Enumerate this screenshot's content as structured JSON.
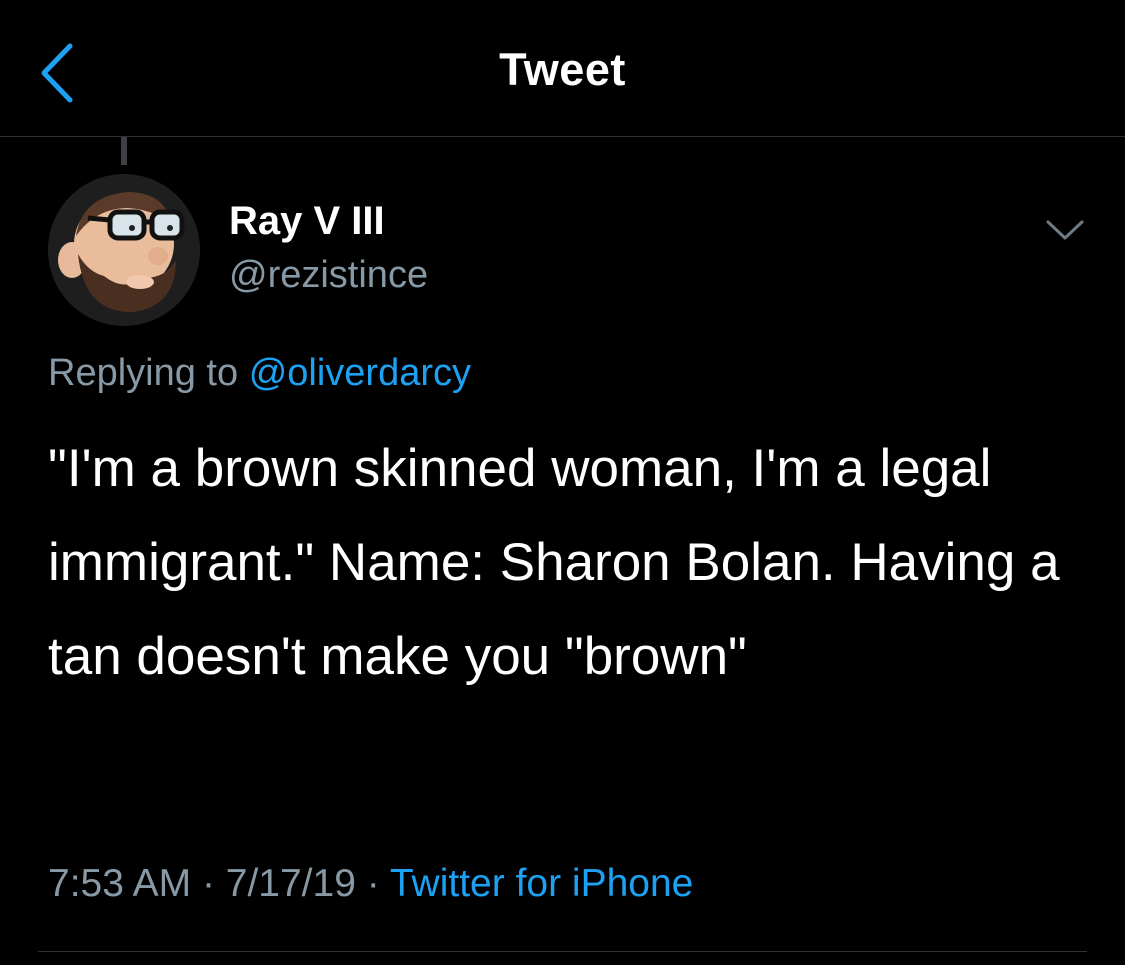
{
  "colors": {
    "background": "#000000",
    "text": "#ffffff",
    "secondary_text": "#8899a6",
    "accent": "#1da1f2",
    "divider": "#2f3336"
  },
  "nav": {
    "back_icon": "chevron-left-icon",
    "title": "Tweet"
  },
  "tweet": {
    "author": {
      "display_name": "Ray V III",
      "handle": "@rezistince",
      "avatar": "cartoon-avatar-bearded-man-with-glasses"
    },
    "menu_icon": "chevron-down-icon",
    "replying_prefix": "Replying to",
    "replying_to": "@oliverdarcy",
    "text": "\"I'm a brown skinned woman, I'm a legal immigrant.\" Name: Sharon Bolan. Having a tan doesn't make you \"brown\"",
    "time": "7:53 AM",
    "date": "7/17/19",
    "separator": "·",
    "source": "Twitter for iPhone"
  }
}
